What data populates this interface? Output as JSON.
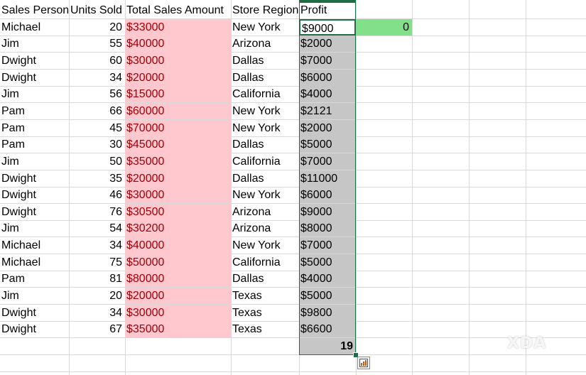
{
  "headers": [
    "Sales Person",
    "Units Sold",
    "Total Sales Amount",
    "Store Region",
    "Profit"
  ],
  "rows": [
    [
      "Michael",
      "20",
      "$33000",
      "New York",
      "$9000"
    ],
    [
      "Jim",
      "55",
      "$40000",
      "Arizona",
      "$2000"
    ],
    [
      "Dwight",
      "60",
      "$30000",
      "Dallas",
      "$7000"
    ],
    [
      "Dwight",
      "34",
      "$20000",
      "Dallas",
      "$6000"
    ],
    [
      "Jim",
      "56",
      "$15000",
      "California",
      "$4000"
    ],
    [
      "Pam",
      "66",
      "$60000",
      "New York",
      "$2121"
    ],
    [
      "Pam",
      "45",
      "$70000",
      "New York",
      "$2000"
    ],
    [
      "Pam",
      "30",
      "$45000",
      "Dallas",
      "$5000"
    ],
    [
      "Jim",
      "50",
      "$35000",
      "California",
      "$7000"
    ],
    [
      "Dwight",
      "35",
      "$20000",
      "Dallas",
      "$11000"
    ],
    [
      "Dwight",
      "46",
      "$30000",
      "New York",
      "$6000"
    ],
    [
      "Dwight",
      "76",
      "$30500",
      "Arizona",
      "$9000"
    ],
    [
      "Jim",
      "54",
      "$30200",
      "Arizona",
      "$8000"
    ],
    [
      "Michael",
      "34",
      "$40000",
      "New York",
      "$7000"
    ],
    [
      "Michael",
      "75",
      "$50000",
      "California",
      "$5000"
    ],
    [
      "Pam",
      "81",
      "$80000",
      "Dallas",
      "$4000"
    ],
    [
      "Jim",
      "20",
      "$20000",
      "Texas",
      "$5000"
    ],
    [
      "Dwight",
      "34",
      "$30000",
      "Texas",
      "$9800"
    ],
    [
      "Dwight",
      "67",
      "$35000",
      "Texas",
      "$6600"
    ]
  ],
  "side_cell_value": "0",
  "count_value": "19",
  "watermark": "XDA",
  "colors": {
    "highlight_fill": "#ffc7ce",
    "highlight_text": "#9c0006",
    "selection_fill": "#c6c6c6",
    "side_cell_fill": "#82e08a",
    "selection_border": "#1f6e43",
    "gridline": "#d9d9d9"
  },
  "icons": {
    "quick_analysis": "quick-analysis-icon"
  }
}
